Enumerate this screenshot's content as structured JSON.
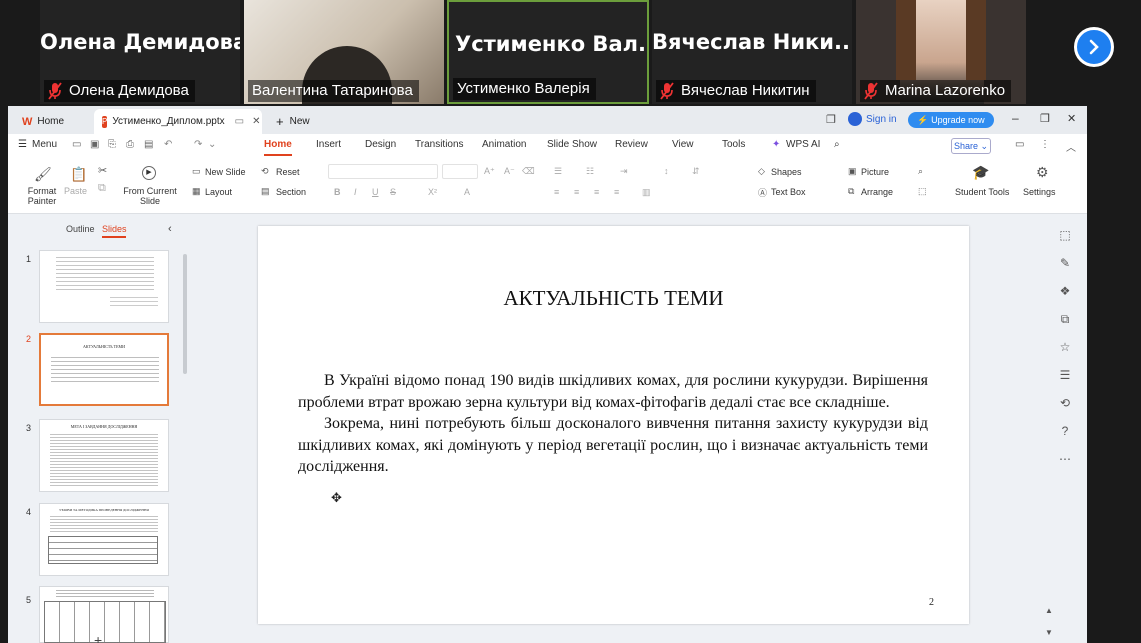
{
  "participants": [
    {
      "big_name": "Олена Демидова",
      "label": "Олена Демидова",
      "muted": true
    },
    {
      "big_name": "",
      "label": "Валентина Татаринова",
      "muted": false
    },
    {
      "big_name": "Устименко Вал...",
      "label": "Устименко Валерія",
      "muted": false
    },
    {
      "big_name": "Вячеслав Ники...",
      "label": "Вячеслав Никитин",
      "muted": true
    },
    {
      "big_name": "",
      "label": "Marina Lazorenko",
      "muted": true
    }
  ],
  "tabs": {
    "home": "Home",
    "file": "Устименко_Диплом.pptx",
    "new": "New"
  },
  "titlebar": {
    "sign_in": "Sign in",
    "upgrade": "Upgrade now"
  },
  "menu": {
    "menu": "Menu",
    "home": "Home",
    "insert": "Insert",
    "design": "Design",
    "transitions": "Transitions",
    "animation": "Animation",
    "slideshow": "Slide Show",
    "review": "Review",
    "view": "View",
    "tools": "Tools",
    "wps_ai": "WPS AI",
    "share": "Share"
  },
  "ribbon": {
    "format_painter": "Format Painter",
    "paste": "Paste",
    "from_current_slide": "From Current Slide",
    "new_slide": "New Slide",
    "layout": "Layout",
    "reset": "Reset",
    "section": "Section",
    "shapes": "Shapes",
    "picture": "Picture",
    "text_box": "Text Box",
    "arrange": "Arrange",
    "student_tools": "Student Tools",
    "settings": "Settings"
  },
  "panel": {
    "outline": "Outline",
    "slides": "Slides"
  },
  "thumbs": [
    "1",
    "2",
    "3",
    "4",
    "5"
  ],
  "slide": {
    "title": "АКТУАЛЬНІСТЬ ТЕМИ",
    "para1": "В Україні відомо понад 190 видів шкідливих комах, для рослини кукурудзи. Вирішення проблеми втрат врожаю зерна культури від комах-фітофагів дедалі стає все складніше.",
    "para2": "Зокрема, нині потребують більш досконалого вивчення питання захисту кукурудзи від шкідливих комах, які домінують у період вегетації рослин, що і визначає актуальність теми дослідження.",
    "page": "2"
  },
  "thumb_text": {
    "t2": "АКТУАЛЬНІСТЬ ТЕМИ",
    "t3": "МЕТА І ЗАВДАННЯ ДОСЛІДЖЕННЯ",
    "t4": "УМОВИ ТА МЕТОДИКА ПРОВЕДЕННЯ ДОСЛІДЖЕННЯ"
  },
  "colors": {
    "accent": "#e0421e",
    "sign_in": "#2a62d6",
    "upgrade": "#2f8cf0",
    "zoom_blue": "#1e7ff0",
    "selected_thumb": "#e47a3a"
  }
}
